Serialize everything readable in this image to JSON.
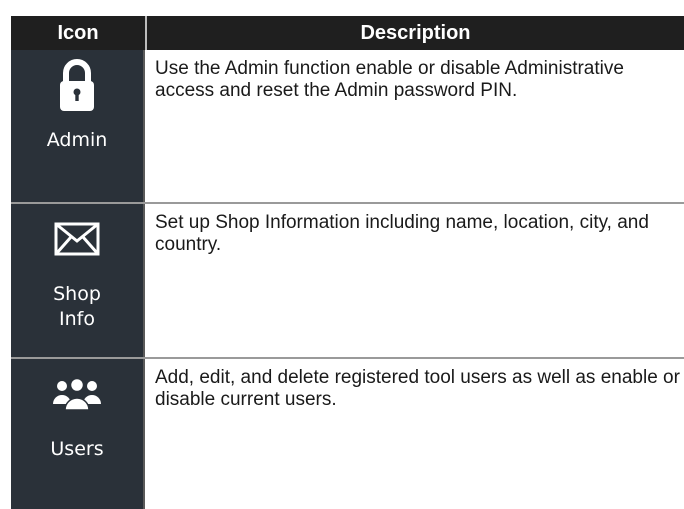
{
  "table": {
    "headers": {
      "icon": "Icon",
      "description": "Description"
    },
    "rows": [
      {
        "icon": "lock-icon",
        "label": "Admin",
        "description": "Use the Admin function enable or disable Administrative access and reset the Admin password PIN."
      },
      {
        "icon": "envelope-icon",
        "label": "Shop Info",
        "description": "Set up Shop Information including name, location, city, and country."
      },
      {
        "icon": "users-icon",
        "label": "Users",
        "description": "Add, edit, and delete registered tool users as well as enable or disable current users."
      }
    ]
  },
  "colors": {
    "header_bg": "#1f1f1f",
    "icon_cell_bg": "#2a3139",
    "header_text": "#ffffff"
  }
}
